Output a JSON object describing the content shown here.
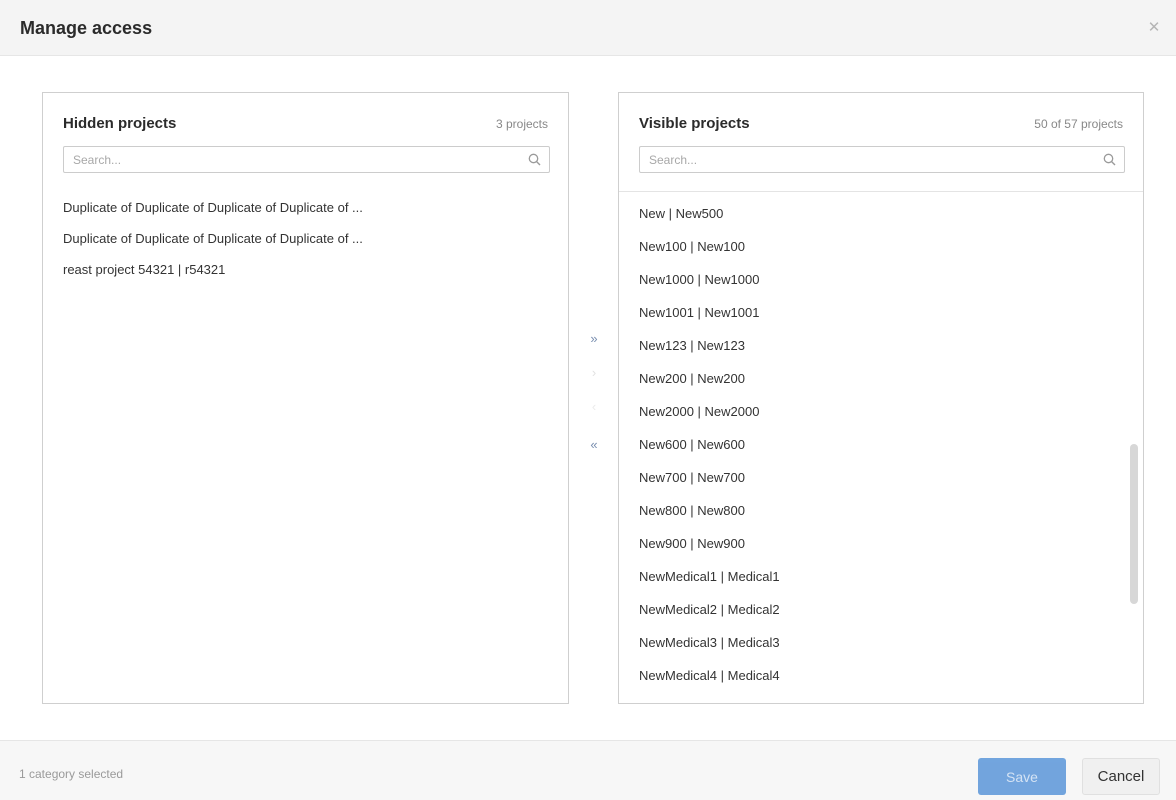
{
  "dialog": {
    "title": "Manage access",
    "close_icon": "close-icon"
  },
  "hidden_panel": {
    "title": "Hidden projects",
    "count": "3 projects",
    "search_placeholder": "Search...",
    "search_value": "",
    "items": [
      "Duplicate of Duplicate of Duplicate of Duplicate of ...",
      "Duplicate of Duplicate of Duplicate of Duplicate of ...",
      "reast project 54321 | r54321"
    ]
  },
  "visible_panel": {
    "title": "Visible projects",
    "count": "50 of 57 projects",
    "search_placeholder": "Search...",
    "search_value": "",
    "items": [
      "New | New500",
      "New100 | New100",
      "New1000 | New1000",
      "New1001 | New1001",
      "New123 | New123",
      "New200 | New200",
      "New2000 | New2000",
      "New600 | New600",
      "New700 | New700",
      "New800 | New800",
      "New900 | New900",
      "NewMedical1 | Medical1",
      "NewMedical2 | Medical2",
      "NewMedical3 | Medical3",
      "NewMedical4 | Medical4"
    ]
  },
  "transfer_buttons": {
    "move_all_right": "»",
    "move_right": "›",
    "move_left": "‹",
    "move_all_left": "«"
  },
  "footer": {
    "status": "1 category selected",
    "save_label": "Save",
    "cancel_label": "Cancel"
  },
  "colors": {
    "accent": "#5b96d9",
    "header_bg": "#f4f4f4",
    "border": "#cfcfcf"
  }
}
